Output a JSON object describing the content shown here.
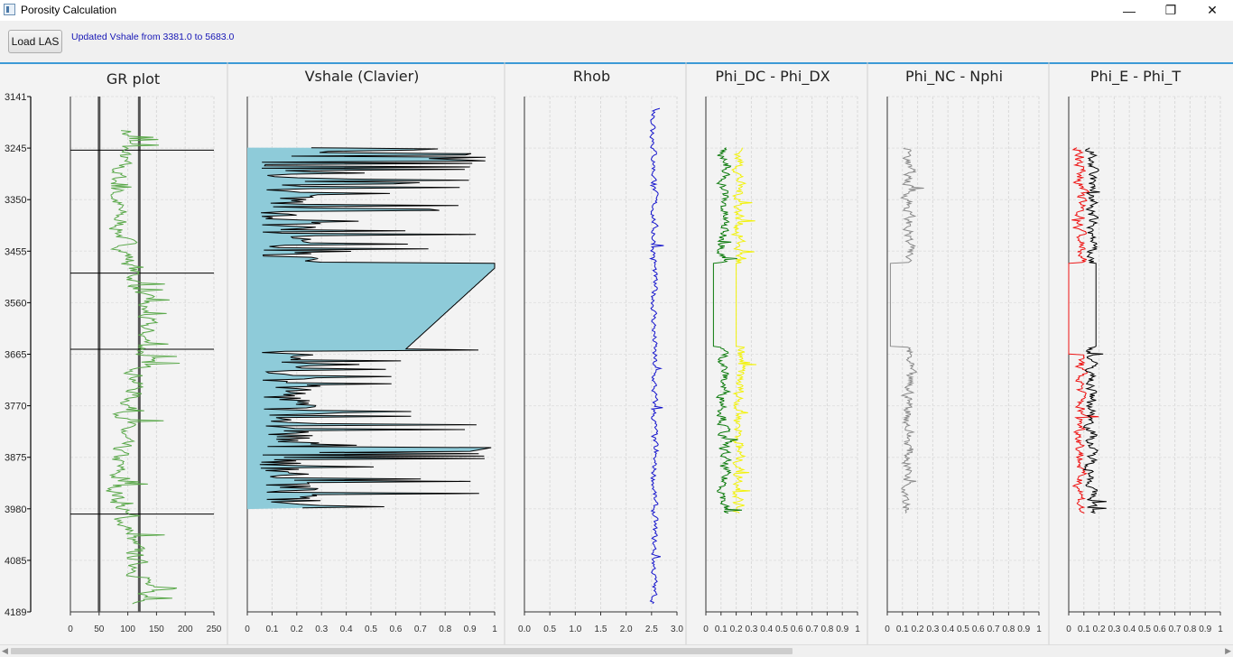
{
  "window": {
    "title": "Porosity Calculation",
    "controls": {
      "minimize": "—",
      "restore": "❐",
      "close": "✕"
    }
  },
  "toolbar": {
    "load_button": "Load LAS",
    "status": "Updated Vshale from 3381.0 to 5683.0"
  },
  "colors": {
    "accent": "#3c9ad6",
    "gr": "#5aa84a",
    "vsh_fill": "#8ecbd9",
    "rhob": "#1515cc",
    "phi_dc": "#0b7a0b",
    "phi_dx": "#f2f20a",
    "phi_nc": "#8a8a8a",
    "phi_e": "#ee1111",
    "phi_t": "#000000",
    "status": "#1515b5"
  },
  "depth_axis": {
    "ticks": [
      "3141",
      "3245",
      "3350",
      "3455",
      "3560",
      "3665",
      "3770",
      "3875",
      "3980",
      "4085",
      "4189"
    ]
  },
  "chart_data": [
    {
      "type": "line",
      "title": "GR plot",
      "xlim": [
        0,
        250
      ],
      "xticks": [
        "0",
        "50",
        "100",
        "150",
        "200",
        "250"
      ],
      "ylim": [
        3141,
        4189
      ],
      "series": [
        {
          "color": "#5aa84a",
          "base": 110,
          "noise": 14
        }
      ],
      "vertical_lines": [
        50,
        120
      ],
      "depth_markers": [
        3250,
        3500,
        3655,
        3990
      ]
    },
    {
      "type": "area",
      "title": "Vshale (Clavier)",
      "xlim": [
        0,
        1
      ],
      "xticks": [
        "0",
        "0.1",
        "0.2",
        "0.3",
        "0.4",
        "0.5",
        "0.6",
        "0.7",
        "0.8",
        "0.9",
        "1"
      ],
      "ylim": [
        3141,
        4189
      ]
    },
    {
      "type": "line",
      "title": "Rhob",
      "xlim": [
        0,
        3
      ],
      "xticks": [
        "0.0",
        "0.5",
        "1.0",
        "1.5",
        "2.0",
        "2.5",
        "3.0"
      ],
      "ylim": [
        3141,
        4189
      ],
      "series": [
        {
          "color": "#1515cc",
          "base": 2.55,
          "noise": 0.08
        }
      ]
    },
    {
      "type": "line",
      "title": "Phi_DC - Phi_DX",
      "xlim": [
        0,
        1
      ],
      "xticks": [
        "0",
        "0.1",
        "0.2",
        "0.3",
        "0.4",
        "0.5",
        "0.6",
        "0.7",
        "0.8",
        "0.9",
        "1"
      ],
      "ylim": [
        3141,
        4189
      ],
      "series": [
        {
          "color": "#f2f20a",
          "base": 0.22,
          "noise": 0.05
        },
        {
          "color": "#0b7a0b",
          "base": 0.12,
          "noise": 0.05
        }
      ]
    },
    {
      "type": "line",
      "title": "Phi_NC - Nphi",
      "xlim": [
        0,
        1
      ],
      "xticks": [
        "0",
        "0.1",
        "0.2",
        "0.3",
        "0.4",
        "0.5",
        "0.6",
        "0.7",
        "0.8",
        "0.9",
        "1"
      ],
      "ylim": [
        3141,
        4189
      ],
      "series": [
        {
          "color": "#8a8a8a",
          "base": 0.15,
          "noise": 0.05
        }
      ]
    },
    {
      "type": "line",
      "title": "Phi_E - Phi_T",
      "xlim": [
        0,
        1
      ],
      "xticks": [
        "0",
        "0.1",
        "0.2",
        "0.3",
        "0.4",
        "0.5",
        "0.6",
        "0.7",
        "0.8",
        "0.9",
        "1"
      ],
      "ylim": [
        3141,
        4189
      ],
      "series": [
        {
          "color": "#ee1111",
          "base": 0.12,
          "noise": 0.05
        },
        {
          "color": "#000000",
          "base": 0.16,
          "noise": 0.05
        }
      ]
    }
  ]
}
